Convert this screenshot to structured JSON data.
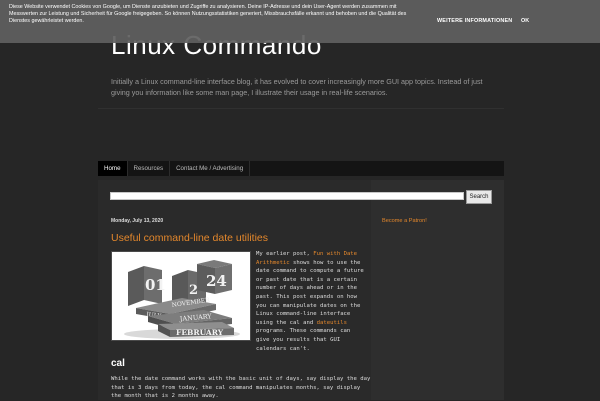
{
  "cookie_banner": {
    "text": "Diese Website verwendet Cookies von Google, um Dienste anzubieten und Zugriffe zu analysieren. Deine IP-Adresse und dein User-Agent werden zusammen mit Messwerten zur Leistung und Sicherheit für Google freigegeben. So können Nutzungsstatistiken generiert, Missbrauchsfälle erkannt und behoben und die Qualität des Dienstes gewährleistet werden.",
    "more_info": "WEITERE INFORMATIONEN",
    "ok": "OK"
  },
  "header": {
    "title": "Linux Commando",
    "description": "Initially a Linux command-line interface blog, it has evolved to cover increasingly more GUI app topics. Instead of just giving you information like some man page, I illustrate their usage in real-life scenarios."
  },
  "tabs": [
    {
      "label": "Home",
      "active": true
    },
    {
      "label": "Resources",
      "active": false
    },
    {
      "label": "Contact Me / Advertising",
      "active": false
    }
  ],
  "search": {
    "button": "Search",
    "value": ""
  },
  "post": {
    "date": "Monday, July 13, 2020",
    "title": "Useful command-line date utilities",
    "image_labels": {
      "block_day_1": "01",
      "block_day_2": "24",
      "month_1": "JULY",
      "month_2": "JANUARY",
      "month_3": "FEBRUARY",
      "month_4": "NOVEMBER"
    },
    "body_intro": "My earlier post, ",
    "body_link": "Fun with Date Arithmetic",
    "body_mid": " shows how to use the date command to compute a future or past date that is a certain number of days ahead or in the past. This post expands on how you can manipulate dates on the Linux command-line interface using the cal and ",
    "body_link2": "dateutils",
    "body_end": " programs. These commands can give you results that GUI calendars can't.",
    "section_heading": "cal",
    "para2": "While the date command works with the basic unit of days, say display the day that is 3 days from today, the cal command manipulates months, say display the month that is 2 months away."
  },
  "sidebar": {
    "patron_link": "Become a Patron!"
  },
  "colors": {
    "accent": "#e3872c",
    "background": "#262626",
    "banner": "#606060"
  }
}
